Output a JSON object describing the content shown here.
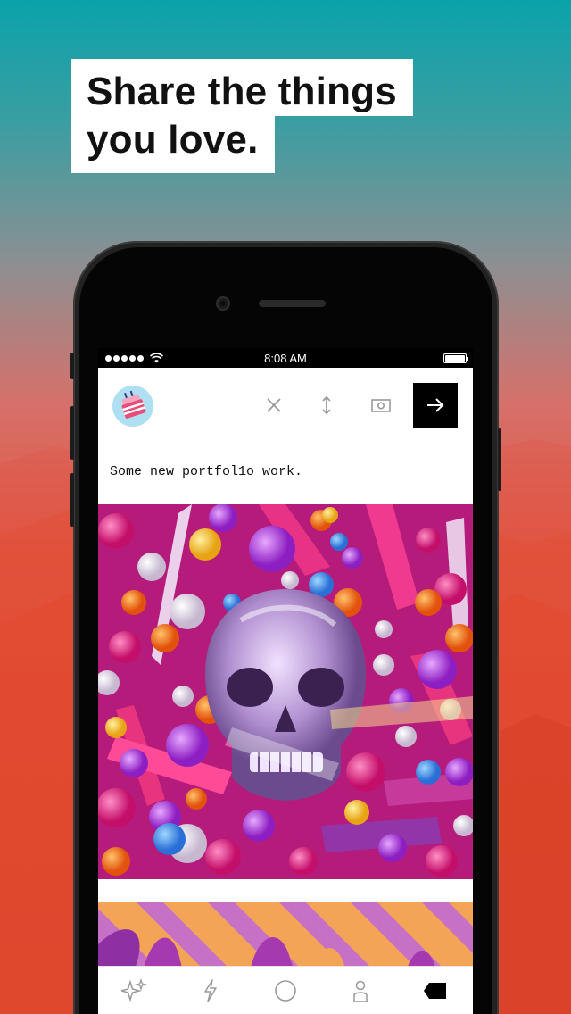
{
  "marketing": {
    "headline_line1": "Share the things",
    "headline_line2": "you love."
  },
  "status_bar": {
    "time": "8:08 AM",
    "signal_bars": 5
  },
  "composer": {
    "caption": "Some new portfol1o work.",
    "avatar_icon": "cake-avatar-icon",
    "actions": [
      {
        "name": "close-icon",
        "label": "Close"
      },
      {
        "name": "reorder-icon",
        "label": "Reorder"
      },
      {
        "name": "camera-icon",
        "label": "Camera"
      },
      {
        "name": "arrow-right-icon",
        "label": "Post"
      }
    ]
  },
  "tabbar": {
    "tabs": [
      {
        "name": "explore-sparkle-icon"
      },
      {
        "name": "activity-lightning-icon"
      },
      {
        "name": "home-circle-icon"
      },
      {
        "name": "account-person-icon"
      },
      {
        "name": "compose-pencil-icon"
      }
    ]
  },
  "colors": {
    "accent": "#000000",
    "background_top": "#0aa3aa",
    "background_bottom": "#dc3f22"
  }
}
